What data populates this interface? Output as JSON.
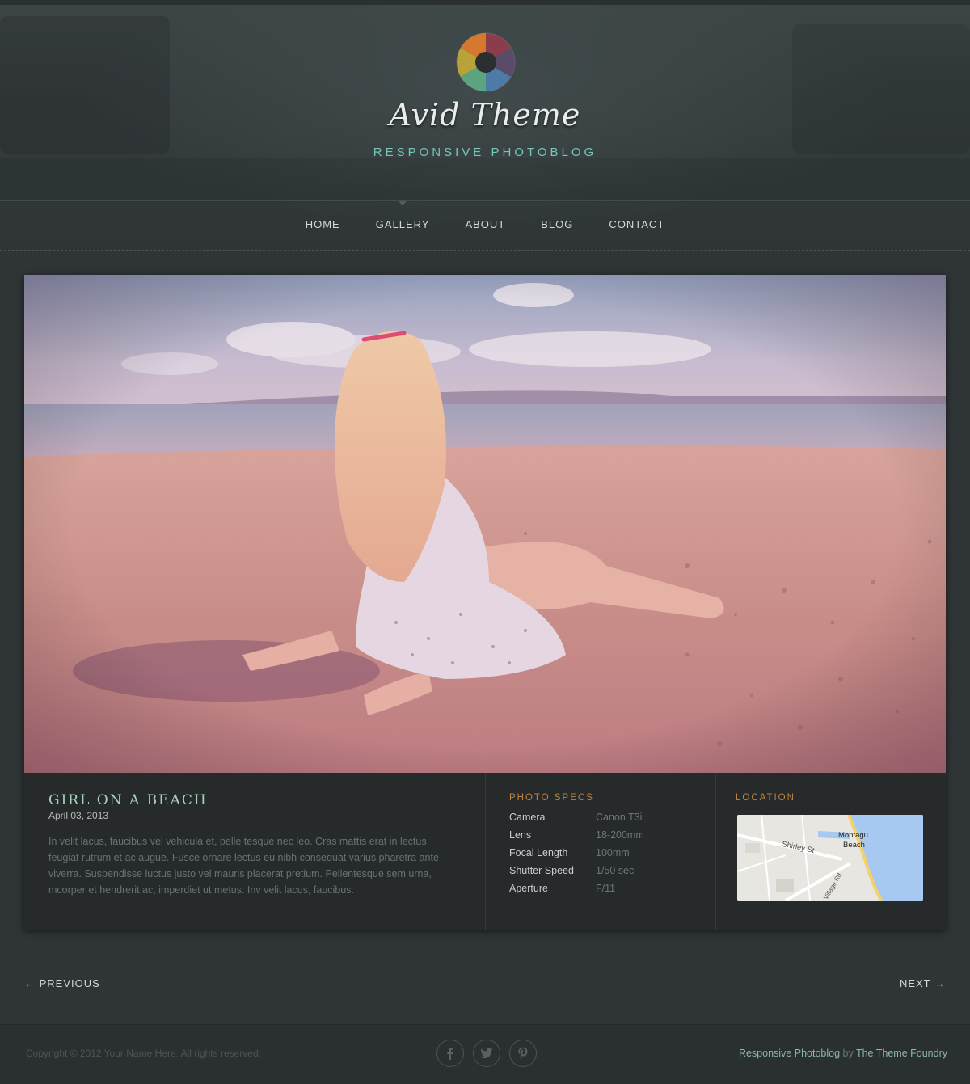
{
  "header": {
    "site_title": "Avid Theme",
    "tagline": "RESPONSIVE PHOTOBLOG",
    "logo_icon": "camera-aperture-icon"
  },
  "nav": {
    "items": [
      {
        "label": "HOME",
        "active": false
      },
      {
        "label": "GALLERY",
        "active": true
      },
      {
        "label": "ABOUT",
        "active": false
      },
      {
        "label": "BLOG",
        "active": false
      },
      {
        "label": "CONTACT",
        "active": false
      }
    ]
  },
  "post": {
    "title": "GIRL ON A BEACH",
    "date": "April 03, 2013",
    "body": "In velit lacus, faucibus vel vehicula et, pelle tesque nec leo. Cras mattis erat in lectus feugiat rutrum et ac augue. Fusce ornare lectus eu nibh consequat varius pharetra ante viverra. Suspendisse luctus justo vel mauris placerat pretium. Pellentesque sem urna, mcorper et hendrerit ac, imperdiet ut metus. Inv velit lacus, faucibus."
  },
  "specs": {
    "heading": "PHOTO SPECS",
    "rows": [
      {
        "label": "Camera",
        "value": "Canon T3i"
      },
      {
        "label": "Lens",
        "value": "18-200mm"
      },
      {
        "label": "Focal Length",
        "value": "100mm"
      },
      {
        "label": "Shutter Speed",
        "value": "1/50 sec"
      },
      {
        "label": "Aperture",
        "value": "F/11"
      }
    ]
  },
  "location": {
    "heading": "LOCATION",
    "map_labels": {
      "place": "Montagu",
      "place2": "Beach",
      "street1": "Shirley St",
      "street2": "Village Rd"
    }
  },
  "pager": {
    "prev": "PREVIOUS",
    "next": "NEXT",
    "prev_arrow": "←",
    "next_arrow": "→"
  },
  "footer": {
    "copyright": "Copyright © 2012 Your Name Here. All rights reserved.",
    "credit_link1": "Responsive Photoblog",
    "credit_by": " by ",
    "credit_link2": "The Theme Foundry",
    "social": [
      "facebook-icon",
      "twitter-icon",
      "pinterest-icon"
    ]
  },
  "colors": {
    "accent_teal": "#73c9b3",
    "accent_orange": "#c0823f",
    "background": "#2f3536"
  }
}
